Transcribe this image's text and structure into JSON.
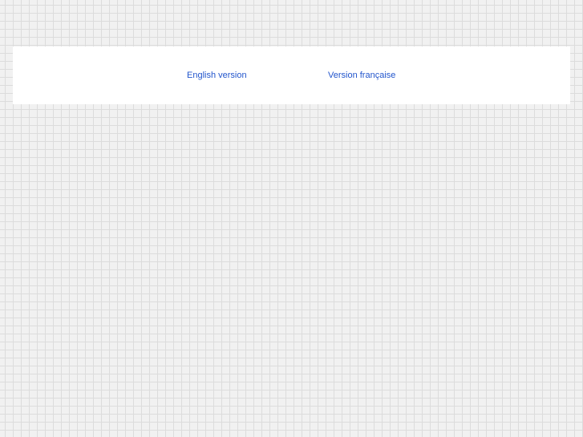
{
  "colors": {
    "link": "#2255cc",
    "panel_background": "#ffffff",
    "page_background": "#f1f1f1",
    "grid_line": "#dcdcdc"
  },
  "language_selector": {
    "english_label": "English version",
    "french_label": "Version française"
  }
}
